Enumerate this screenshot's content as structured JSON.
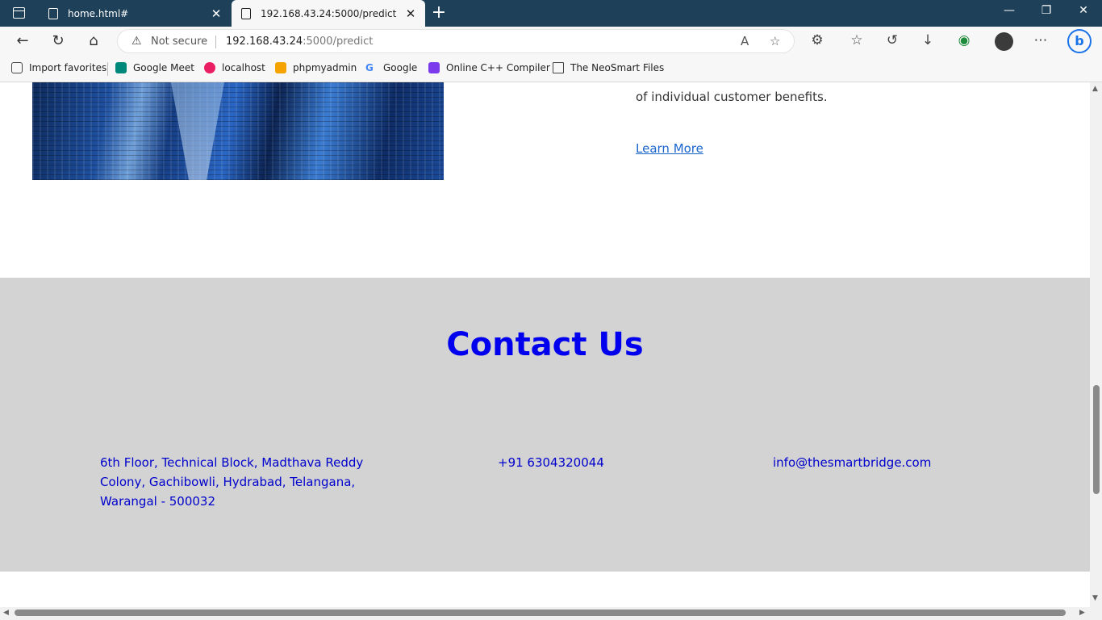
{
  "tabs": [
    {
      "title": "home.html#"
    },
    {
      "title": "192.168.43.24:5000/predict"
    }
  ],
  "address": {
    "security_label": "Not secure",
    "host": "192.168.43.24",
    "path": ":5000/predict"
  },
  "favorites": [
    {
      "label": "Import favorites"
    },
    {
      "label": "Google Meet"
    },
    {
      "label": "localhost"
    },
    {
      "label": "phpmyadmin"
    },
    {
      "label": "Google"
    },
    {
      "label": "Online C++ Compiler"
    },
    {
      "label": "The NeoSmart Files"
    }
  ],
  "content": {
    "body_text": "of individual customer benefits.",
    "learn_more": "Learn More"
  },
  "contact": {
    "title": "Contact Us",
    "address_lines": [
      "6th Floor, Technical Block, Madthava Reddy",
      "Colony, Gachibowli, Hydrabad, Telangana,",
      "Warangal - 500032"
    ],
    "phone": "+91 6304320044",
    "email": "info@thesmartbridge.com"
  },
  "colors": {
    "tabbar": "#1e4059",
    "contact_bg": "#d3d3d3",
    "accent_text": "#0000ee"
  }
}
